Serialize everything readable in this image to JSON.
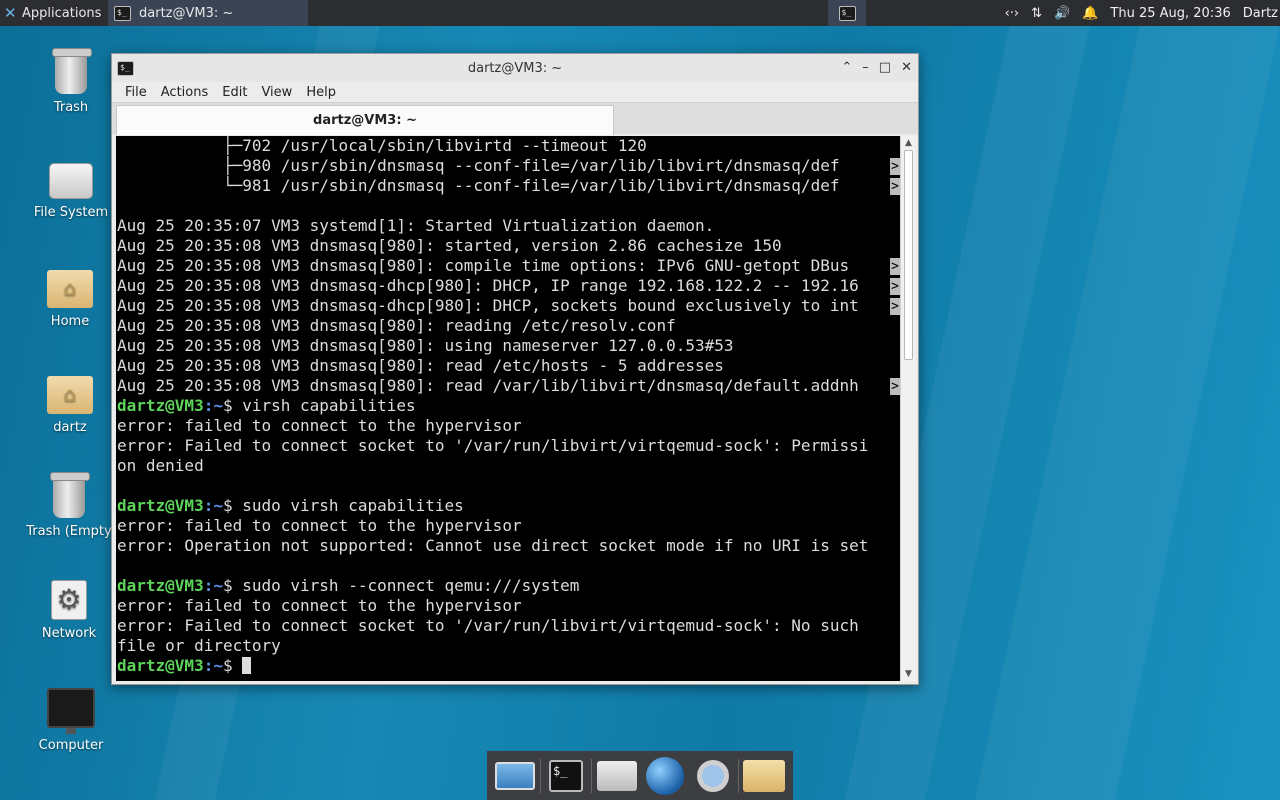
{
  "top_panel": {
    "apps_label": "Applications",
    "task_title": "dartz@VM3: ~",
    "clock": "Thu 25 Aug, 20:36",
    "user": "Dartz"
  },
  "desktop": {
    "icons": [
      {
        "label": "Trash"
      },
      {
        "label": "File System"
      },
      {
        "label": "Home"
      },
      {
        "label": "dartz"
      },
      {
        "label": "Trash (Empty"
      },
      {
        "label": "Network"
      },
      {
        "label": "Computer"
      }
    ]
  },
  "window": {
    "title": "dartz@VM3: ~",
    "menu": [
      "File",
      "Actions",
      "Edit",
      "View",
      "Help"
    ],
    "tab_label": "dartz@VM3: ~"
  },
  "terminal": {
    "prompt_user": "dartz@VM3",
    "prompt_path": ":~",
    "lines": [
      "           ├─702 /usr/local/sbin/libvirtd --timeout 120",
      "           ├─980 /usr/sbin/dnsmasq --conf-file=/var/lib/libvirt/dnsmasq/def",
      "           └─981 /usr/sbin/dnsmasq --conf-file=/var/lib/libvirt/dnsmasq/def",
      "",
      "Aug 25 20:35:07 VM3 systemd[1]: Started Virtualization daemon.",
      "Aug 25 20:35:08 VM3 dnsmasq[980]: started, version 2.86 cachesize 150",
      "Aug 25 20:35:08 VM3 dnsmasq[980]: compile time options: IPv6 GNU-getopt DBus",
      "Aug 25 20:35:08 VM3 dnsmasq-dhcp[980]: DHCP, IP range 192.168.122.2 -- 192.16",
      "Aug 25 20:35:08 VM3 dnsmasq-dhcp[980]: DHCP, sockets bound exclusively to int",
      "Aug 25 20:35:08 VM3 dnsmasq[980]: reading /etc/resolv.conf",
      "Aug 25 20:35:08 VM3 dnsmasq[980]: using nameserver 127.0.0.53#53",
      "Aug 25 20:35:08 VM3 dnsmasq[980]: read /etc/hosts - 5 addresses",
      "Aug 25 20:35:08 VM3 dnsmasq[980]: read /var/lib/libvirt/dnsmasq/default.addnh",
      "$ virsh capabilities",
      "error: failed to connect to the hypervisor",
      "error: Failed to connect socket to '/var/run/libvirt/virtqemud-sock': Permissi",
      "on denied",
      "",
      "$ sudo virsh capabilities",
      "error: failed to connect to the hypervisor",
      "error: Operation not supported: Cannot use direct socket mode if no URI is set",
      "",
      "$ sudo virsh --connect qemu:///system",
      "error: failed to connect to the hypervisor",
      "error: Failed to connect socket to '/var/run/libvirt/virtqemud-sock': No such",
      "file or directory",
      "$ "
    ],
    "truncated_marker": ">"
  }
}
